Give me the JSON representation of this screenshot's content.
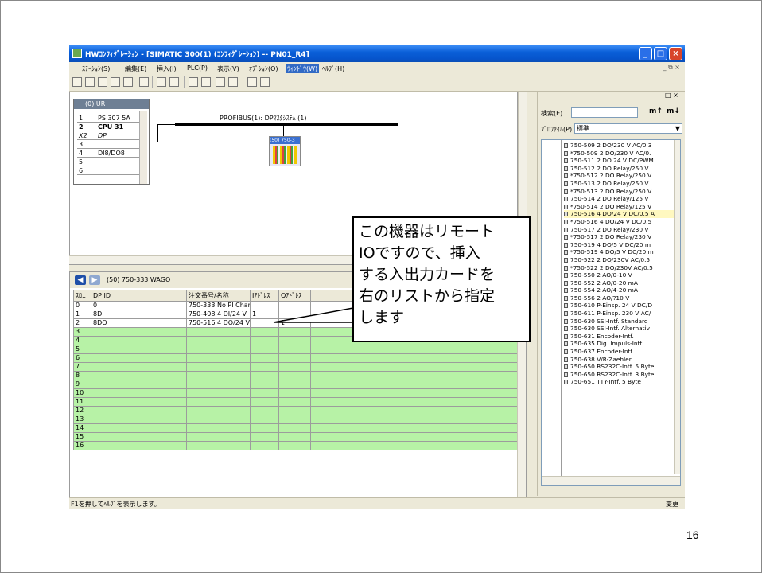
{
  "window": {
    "title": "HWｺﾝﾌｨｸﾞﾚｰｼｮﾝ - [SIMATIC 300(1) (ｺﾝﾌｨｸﾞﾚｰｼｮﾝ) -- PN01_R4]",
    "controls": [
      "_",
      "□",
      "×"
    ]
  },
  "menubar": {
    "items": [
      "ｽﾃｰｼｮﾝ(S)",
      "編集(E)",
      "挿入(I)",
      "PLC(P)",
      "表示(V)",
      "ｵﾌﾟｼｮﾝ(O)",
      "ｳｨﾝﾄﾞｳ(W)",
      "ﾍﾙﾌﾟ(H)"
    ],
    "active_index": 6,
    "mdi_controls": "_ ⧉ ×"
  },
  "station": {
    "rack_title": "(0) UR",
    "rack_rows": [
      {
        "slot": "1",
        "module": "PS 307 5A",
        "bold": false
      },
      {
        "slot": "2",
        "module": "CPU 31",
        "bold": true
      },
      {
        "slot": "X2",
        "module": "DP",
        "bold": false
      },
      {
        "slot": "3",
        "module": "",
        "bold": false
      },
      {
        "slot": "4",
        "module": "DI8/DO8",
        "bold": false
      },
      {
        "slot": "5",
        "module": "",
        "bold": false
      },
      {
        "slot": "6",
        "module": "",
        "bold": false
      }
    ],
    "bus_label": "PROFIBUS(1): DPﾏｽﾀｼｽﾃﾑ (1)",
    "node_label": "(50) 750-3"
  },
  "detail": {
    "title": "(50)   750-333 WAGO",
    "columns": [
      "ｽﾛ..",
      "DP ID",
      "注文番号/名称",
      "Iｱﾄﾞﾚｽ",
      "Qｱﾄﾞﾚｽ",
      ""
    ],
    "rows": [
      {
        "slot": "0",
        "dpid": "0",
        "order": "750-333 No PI Char",
        "iaddr": "",
        "qaddr": "",
        "comment": ""
      },
      {
        "slot": "1",
        "dpid": "8DI",
        "order": "750-408  4 DI/24 V",
        "iaddr": "1",
        "qaddr": "",
        "comment": ""
      },
      {
        "slot": "2",
        "dpid": "8DO",
        "order": "750-516  4 DO/24 V",
        "iaddr": "",
        "qaddr": "1",
        "comment": ""
      },
      {
        "slot": "3"
      },
      {
        "slot": "4"
      },
      {
        "slot": "5"
      },
      {
        "slot": "6"
      },
      {
        "slot": "7"
      },
      {
        "slot": "8"
      },
      {
        "slot": "9"
      },
      {
        "slot": "10"
      },
      {
        "slot": "11"
      },
      {
        "slot": "12"
      },
      {
        "slot": "13"
      },
      {
        "slot": "14"
      },
      {
        "slot": "15"
      },
      {
        "slot": "16"
      }
    ]
  },
  "catalog": {
    "close": "□ ×",
    "search_label": "検索(E)",
    "search_value": "",
    "search_btn_down": "m↑",
    "search_btn_up": "m↓",
    "profile_label": "ﾌﾟﾛﾌｧｲﾙ(P)",
    "profile_value": "標準",
    "items": [
      "750-509  2 DO/230 V AC/0.3",
      "*750-509  2 DO/230 V AC/0.",
      "750-511  2 DO 24 V DC/PWM",
      "750-512  2 DO Relay/250 V",
      "*750-512  2 DO Relay/250 V",
      "750-513  2 DO Relay/250 V",
      "*750-513  2 DO Relay/250 V",
      "750-514  2 DO Relay/125 V",
      "*750-514  2 DO Relay/125 V",
      "750-516  4 DO/24 V DC/0.5 A",
      "*750-516  4 DO/24 V DC/0.5",
      "750-517  2 DO Relay/230 V",
      "*750-517  2 DO Relay/230 V",
      "750-519  4 DO/5 V DC/20 m",
      "*750-519  4 DO/5 V DC/20 m",
      "750-522  2 DO/230V AC/0.5",
      "*750-522  2 DO/230V AC/0.5",
      "750-550  2 AO/0-10 V",
      "750-552  2 AO/0-20 mA",
      "750-554  2 AO/4-20 mA",
      "750-556  2 AO/?10 V",
      "750-610  P-Einsp. 24 V DC/D",
      "750-611  P-Einsp. 230 V AC/",
      "750-630  SSI-Intf. Standard",
      "750-630  SSI-Intf. Alternativ",
      "750-631  Encoder-Intf.",
      "750-635  Dig. Impuls-Intf.",
      "750-637  Encoder-Intf.",
      "750-638  V/R-Zaehler",
      "750-650  RS232C-Intf. 5 Byte",
      "750-650  RS232C-Intf. 3 Byte",
      "750-651  TTY-Intf. 5 Byte"
    ],
    "highlight_index": 9,
    "bottom_button": "ₜₓ"
  },
  "statusbar": {
    "help_text": "F1を押してﾍﾙﾌﾟを表示します。",
    "mode": "変更"
  },
  "callout": {
    "text": "この機器はリモート\nIOですので、挿入\nする入出力カードを\n右のリストから指定\nします"
  },
  "page_number": "16",
  "colors": {
    "empty_slot_green": "#b7f2a6",
    "titlebar_blue": "#0a5fd8",
    "menu_highlight": "#316ac5"
  }
}
